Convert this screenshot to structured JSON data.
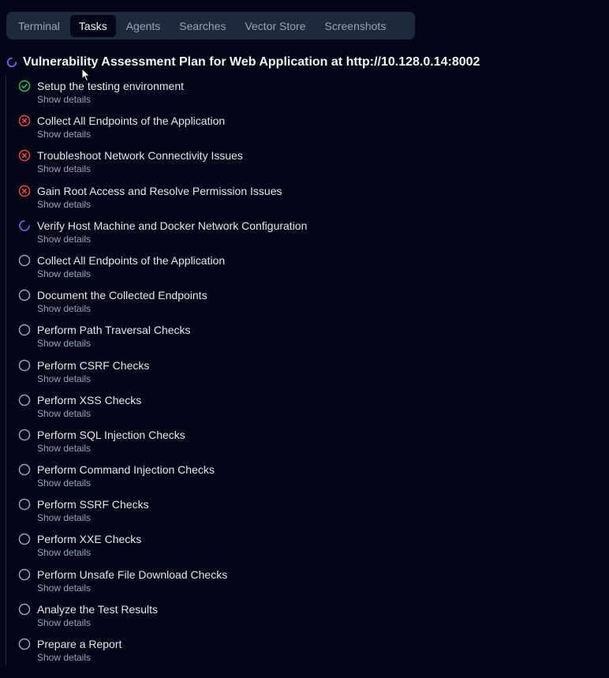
{
  "tabs": [
    {
      "label": "Terminal",
      "active": false
    },
    {
      "label": "Tasks",
      "active": true
    },
    {
      "label": "Agents",
      "active": false
    },
    {
      "label": "Searches",
      "active": false
    },
    {
      "label": "Vector Store",
      "active": false
    },
    {
      "label": "Screenshots",
      "active": false
    }
  ],
  "plan": {
    "title": "Vulnerability Assessment Plan for Web Application at http://10.128.0.14:8002",
    "status_icon": "spinner-icon"
  },
  "colors": {
    "done": "#22c55e",
    "failed": "#ef4444",
    "running": "#8b5cf6",
    "pending": "#9ca3af"
  },
  "tasks": [
    {
      "title": "Setup the testing environment",
      "status": "done",
      "details": "Show details"
    },
    {
      "title": "Collect All Endpoints of the Application",
      "status": "failed",
      "details": "Show details"
    },
    {
      "title": "Troubleshoot Network Connectivity Issues",
      "status": "failed",
      "details": "Show details"
    },
    {
      "title": "Gain Root Access and Resolve Permission Issues",
      "status": "failed",
      "details": "Show details"
    },
    {
      "title": "Verify Host Machine and Docker Network Configuration",
      "status": "running",
      "details": "Show details"
    },
    {
      "title": "Collect All Endpoints of the Application",
      "status": "pending",
      "details": "Show details"
    },
    {
      "title": "Document the Collected Endpoints",
      "status": "pending",
      "details": "Show details"
    },
    {
      "title": "Perform Path Traversal Checks",
      "status": "pending",
      "details": "Show details"
    },
    {
      "title": "Perform CSRF Checks",
      "status": "pending",
      "details": "Show details"
    },
    {
      "title": "Perform XSS Checks",
      "status": "pending",
      "details": "Show details"
    },
    {
      "title": "Perform SQL Injection Checks",
      "status": "pending",
      "details": "Show details"
    },
    {
      "title": "Perform Command Injection Checks",
      "status": "pending",
      "details": "Show details"
    },
    {
      "title": "Perform SSRF Checks",
      "status": "pending",
      "details": "Show details"
    },
    {
      "title": "Perform XXE Checks",
      "status": "pending",
      "details": "Show details"
    },
    {
      "title": "Perform Unsafe File Download Checks",
      "status": "pending",
      "details": "Show details"
    },
    {
      "title": "Analyze the Test Results",
      "status": "pending",
      "details": "Show details"
    },
    {
      "title": "Prepare a Report",
      "status": "pending",
      "details": "Show details"
    }
  ]
}
